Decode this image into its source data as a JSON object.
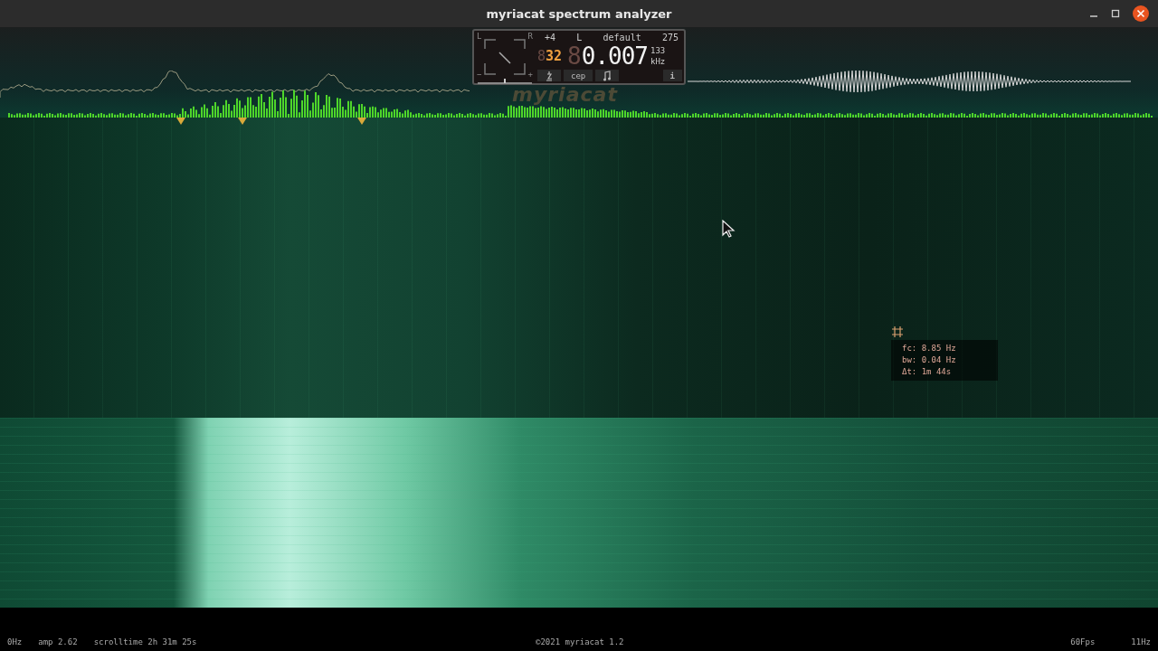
{
  "window": {
    "title": "myriacat spectrum analyzer"
  },
  "panel": {
    "dial": {
      "left": "L",
      "right": "R",
      "minus": "−",
      "plus": "+"
    },
    "top_row": [
      "+4",
      "L",
      "default",
      "275"
    ],
    "octave": {
      "ghost": "8",
      "value": "32"
    },
    "frequency": {
      "ghost": "8",
      "value": "0.007",
      "upper": "133",
      "unit": "kHz"
    },
    "buttons": [
      {
        "kind": "icon"
      },
      {
        "kind": "text",
        "label": "cep"
      },
      {
        "kind": "icon"
      }
    ],
    "info": "i"
  },
  "logo": "myriacat",
  "tooltip": {
    "lines": [
      "fc: 8.85 Hz",
      "bw: 0.04 Hz",
      "Δt: 1m 44s"
    ]
  },
  "status_bar": {
    "left": [
      "0Hz",
      "amp 2.62",
      "scrolltime 2h 31m 25s"
    ],
    "center": "©2021 myriacat 1.2",
    "right": [
      "60Fps",
      "11Hz"
    ]
  }
}
